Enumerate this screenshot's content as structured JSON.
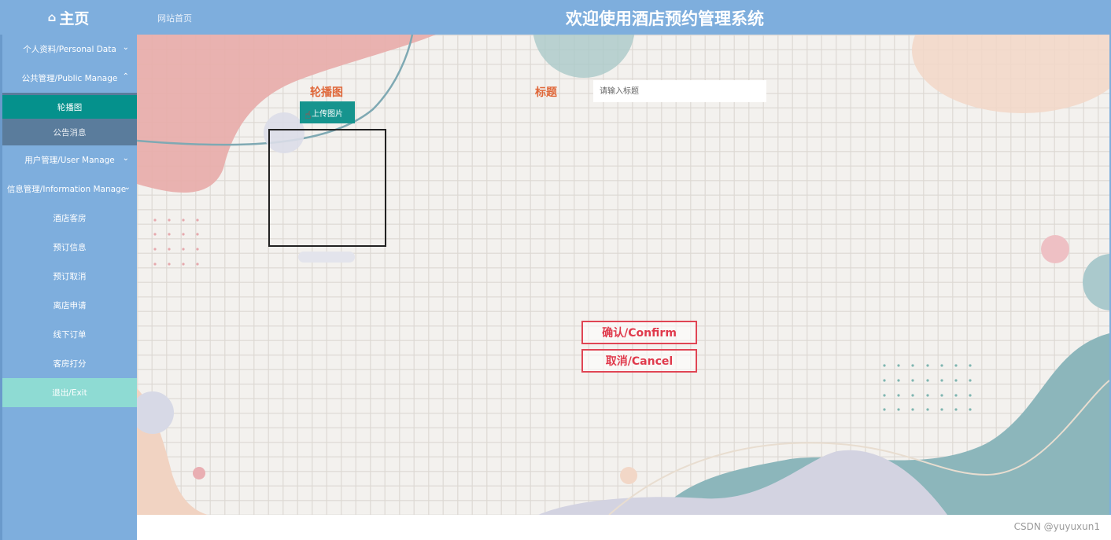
{
  "header": {
    "home_icon": "home-icon",
    "home_label": "主页",
    "site_link": "网站首页",
    "title": "欢迎使用酒店预约管理系统"
  },
  "sidebar": {
    "items": [
      {
        "label": "个人资料/Personal Data",
        "chevron": "chevron-down-icon"
      },
      {
        "label": "公共管理/Public Manage",
        "chevron": "chevron-up-icon"
      },
      {
        "label": "轮播图"
      },
      {
        "label": "公告消息"
      },
      {
        "label": "用户管理/User Manage",
        "chevron": "chevron-down-icon"
      },
      {
        "label": "信息管理/Information Manage",
        "chevron": "chevron-down-icon"
      },
      {
        "label": "酒店客房"
      },
      {
        "label": "预订信息"
      },
      {
        "label": "预订取消"
      },
      {
        "label": "离店申请"
      },
      {
        "label": "线下订单"
      },
      {
        "label": "客房打分"
      },
      {
        "label": "退出/Exit"
      }
    ]
  },
  "form": {
    "carousel_label": "轮播图",
    "upload_button": "上传图片",
    "title_label": "标题",
    "title_placeholder": "请输入标题",
    "title_value": ""
  },
  "actions": {
    "confirm": "确认/Confirm",
    "cancel": "取消/Cancel"
  },
  "footer": {
    "watermark": "CSDN @yuyuxun1"
  },
  "colors": {
    "header_bg": "#7eaedd",
    "sidebar_active": "#05918c",
    "label_orange": "#e0683a",
    "button_red": "#e04554"
  }
}
